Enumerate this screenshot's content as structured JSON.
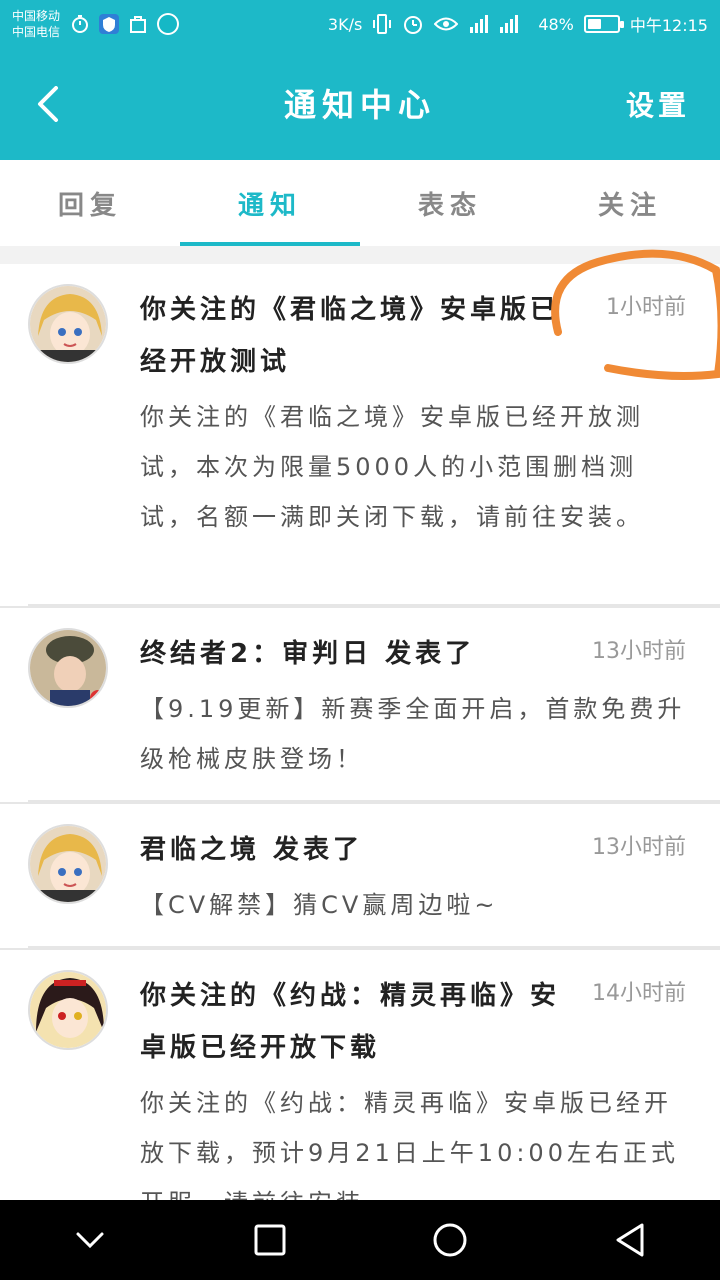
{
  "status_bar": {
    "carrier_1": "中国移动",
    "carrier_2": "中国电信",
    "speed": "3K/s",
    "signal_label": "2G 4G 2G",
    "battery_percent": "48%",
    "battery_level": 0.48,
    "time": "中午12:15"
  },
  "app_bar": {
    "back_icon": "chevron-left-icon",
    "title": "通知中心",
    "settings_label": "设置"
  },
  "tabs": [
    {
      "label": "回复",
      "active": false
    },
    {
      "label": "通知",
      "active": true
    },
    {
      "label": "表态",
      "active": false
    },
    {
      "label": "关注",
      "active": false
    }
  ],
  "notifications": [
    {
      "avatar": "anime-blonde-girl-avatar",
      "title": "你关注的《君临之境》安卓版已经开放测试",
      "time": "1小时前",
      "body": "你关注的《君临之境》安卓版已经开放测试，本次为限量5000人的小范围删档测试，名额一满即关闭下载，请前往安装。"
    },
    {
      "avatar": "soldier-girl-avatar",
      "title": "终结者2：审判日 发表了",
      "time": "13小时前",
      "body": "【9.19更新】新赛季全面开启，首款免费升级枪械皮肤登场！"
    },
    {
      "avatar": "anime-blonde-girl-avatar",
      "title": "君临之境 发表了",
      "time": "13小时前",
      "body": "【CV解禁】猜CV赢周边啦~"
    },
    {
      "avatar": "anime-dark-hair-girl-avatar",
      "title": "你关注的《约战：精灵再临》安卓版已经开放下载",
      "time": "14小时前",
      "body": "你关注的《约战：精灵再临》安卓版已经开放下载，预计9月21日上午10:00左右正式开服，请前往安装"
    }
  ],
  "nav_bar": {
    "back_icon": "triangle-back-icon",
    "home_icon": "circle-home-icon",
    "recents_icon": "square-recents-icon",
    "hide_icon": "chevron-down-icon"
  },
  "colors": {
    "accent": "#1db9c8",
    "annotation": "#f08a35"
  }
}
